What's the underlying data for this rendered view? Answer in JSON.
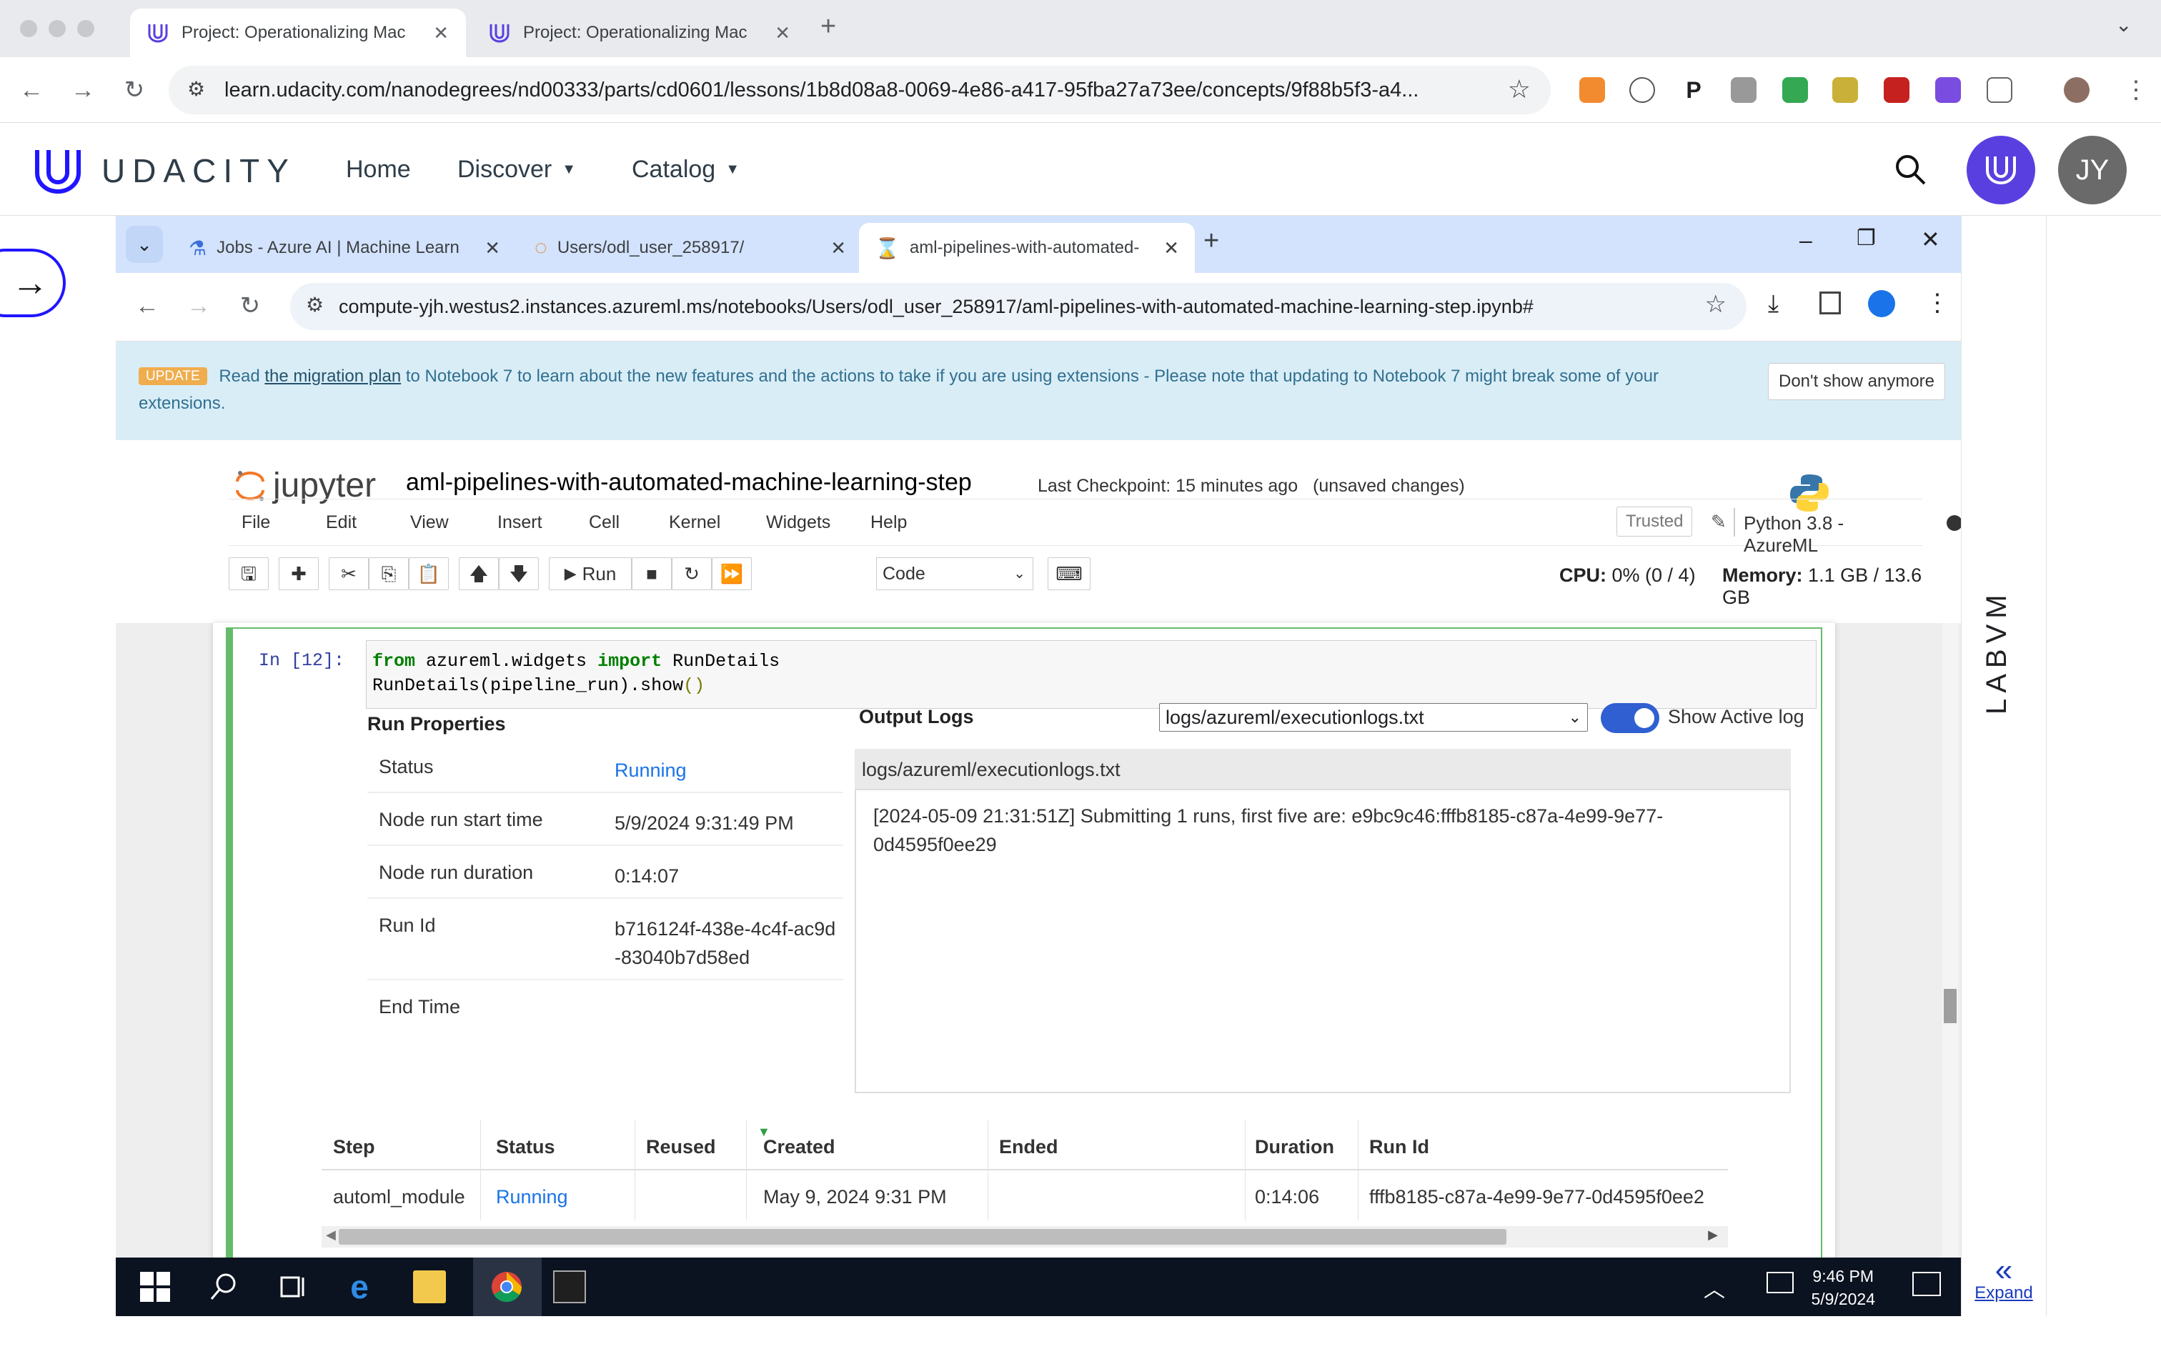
{
  "browser": {
    "tabs": [
      {
        "label": "Project: Operationalizing Mac",
        "active": true
      },
      {
        "label": "Project: Operationalizing Mac",
        "active": false
      }
    ],
    "url": "learn.udacity.com/nanodegrees/nd00333/parts/cd0601/lessons/1b8d08a8-0069-4e86-a417-95fba27a73ee/concepts/9f88b5f3-a4..."
  },
  "udacity": {
    "logo": "UDACITY",
    "nav": {
      "home": "Home",
      "discover": "Discover",
      "catalog": "Catalog"
    },
    "avatar_initials": "JY",
    "side_label": "LABVM",
    "expand_label": "Expand"
  },
  "vm_browser": {
    "tabs": [
      {
        "label": "Jobs - Azure AI | Machine Learn"
      },
      {
        "label": "Users/odl_user_258917/"
      },
      {
        "label": "aml-pipelines-with-automated-"
      }
    ],
    "url": "compute-yjh.westus2.instances.azureml.ms/notebooks/Users/odl_user_258917/aml-pipelines-with-automated-machine-learning-step.ipynb#"
  },
  "banner": {
    "badge": "UPDATE",
    "text_before": "Read",
    "link": "the migration plan",
    "text_after": "to Notebook 7 to learn about the new features and the actions to take if you are using extensions - Please note that updating to Notebook 7 might break some of your extensions.",
    "dismiss": "Don't show anymore"
  },
  "jupyter": {
    "logo": "jupyter",
    "notebook_title": "aml-pipelines-with-automated-machine-learning-step",
    "checkpoint": "Last Checkpoint: 15 minutes ago",
    "unsaved": "(unsaved changes)",
    "menu": [
      "File",
      "Edit",
      "View",
      "Insert",
      "Cell",
      "Kernel",
      "Widgets",
      "Help"
    ],
    "trusted": "Trusted",
    "kernel": "Python 3.8 - AzureML",
    "run_label": "Run",
    "cell_type": "Code",
    "cpu_label": "CPU:",
    "cpu_value": "0% (0 / 4)",
    "mem_label": "Memory:",
    "mem_value": "1.1 GB / 13.6 GB"
  },
  "cell": {
    "prompt": "In [12]:",
    "code": {
      "l1_kw1": "from",
      "l1_mod": " azureml.widgets ",
      "l1_kw2": "import",
      "l1_name": " RunDetails",
      "l2": "RunDetails(pipeline_run).show",
      "l2_paren": "()"
    }
  },
  "run_properties": {
    "heading": "Run Properties",
    "rows": [
      {
        "label": "Status",
        "value": "Running"
      },
      {
        "label": "Node run start time",
        "value": "5/9/2024 9:31:49 PM"
      },
      {
        "label": "Node run duration",
        "value": "0:14:07"
      },
      {
        "label": "Run Id",
        "value": "b716124f-438e-4c4f-ac9d-83040b7d58ed"
      },
      {
        "label": "End Time",
        "value": ""
      }
    ]
  },
  "output_logs": {
    "heading": "Output Logs",
    "selected_log": "logs/azureml/executionlogs.txt",
    "toggle_label": "Show Active log",
    "toggle_on": true,
    "log_path": "logs/azureml/executionlogs.txt",
    "log_text": "[2024-05-09 21:31:51Z] Submitting 1 runs, first five are: e9bc9c46:fffb8185-c87a-4e99-9e77-0d4595f0ee29"
  },
  "steps_table": {
    "headers": [
      "Step",
      "Status",
      "Reused",
      "Created",
      "Ended",
      "Duration",
      "Run Id"
    ],
    "rows": [
      [
        "automl_module",
        "Running",
        "",
        "May 9, 2024 9:31 PM",
        "",
        "0:14:06",
        "fffb8185-c87a-4e99-9e77-0d4595f0ee2"
      ]
    ]
  },
  "taskbar": {
    "time": "9:46 PM",
    "date": "5/9/2024"
  },
  "colors": {
    "udacity_purple": "#5a3fe0",
    "cell_border": "#66bb6a",
    "running": "#1a73e8",
    "banner_bg": "#d9edf7"
  }
}
